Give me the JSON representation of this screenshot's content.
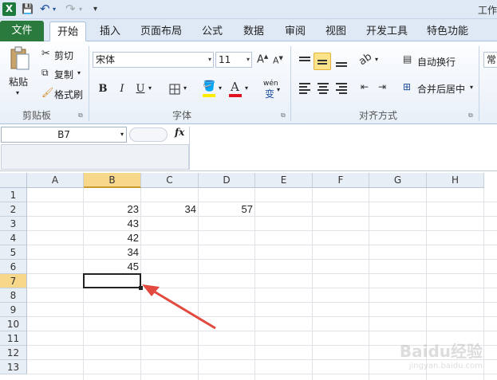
{
  "window": {
    "title": "工作"
  },
  "qat": {
    "logo": "X",
    "save": "💾",
    "undo": "↶",
    "redo": "↷",
    "customize": "▾"
  },
  "tabs": [
    {
      "label": "文件"
    },
    {
      "label": "开始"
    },
    {
      "label": "插入"
    },
    {
      "label": "页面布局"
    },
    {
      "label": "公式"
    },
    {
      "label": "数据"
    },
    {
      "label": "审阅"
    },
    {
      "label": "视图"
    },
    {
      "label": "开发工具"
    },
    {
      "label": "特色功能"
    }
  ],
  "clipboard": {
    "paste": "粘贴",
    "cut": "剪切",
    "copy": "复制",
    "format_painter": "格式刷",
    "group_label": "剪贴板"
  },
  "font": {
    "name": "宋体",
    "size": "11",
    "bold": "B",
    "italic": "I",
    "underline": "U",
    "wen": "wén",
    "group_label": "字体"
  },
  "alignment": {
    "wrap": "自动换行",
    "merge": "合并后居中",
    "group_label": "对齐方式"
  },
  "number": {
    "format": "常"
  },
  "formula_bar": {
    "cell_ref": "B7",
    "fx": "fx",
    "content": ""
  },
  "grid": {
    "columns": [
      "A",
      "B",
      "C",
      "D",
      "E",
      "F",
      "G",
      "H"
    ],
    "rows": [
      "1",
      "2",
      "3",
      "4",
      "5",
      "6",
      "7",
      "8",
      "9",
      "10",
      "11",
      "12",
      "13"
    ],
    "selected_column": "B",
    "selected_row": "7",
    "cells": [
      {
        "ref": "B2",
        "value": "23"
      },
      {
        "ref": "C2",
        "value": "34"
      },
      {
        "ref": "D2",
        "value": "57"
      },
      {
        "ref": "B3",
        "value": "43"
      },
      {
        "ref": "B4",
        "value": "42"
      },
      {
        "ref": "B5",
        "value": "34"
      },
      {
        "ref": "B6",
        "value": "45"
      }
    ]
  },
  "annotation": {
    "color": "#e24a3f"
  },
  "watermark": {
    "brand": "Baidu经验",
    "url": "jingyan.baidu.com"
  }
}
